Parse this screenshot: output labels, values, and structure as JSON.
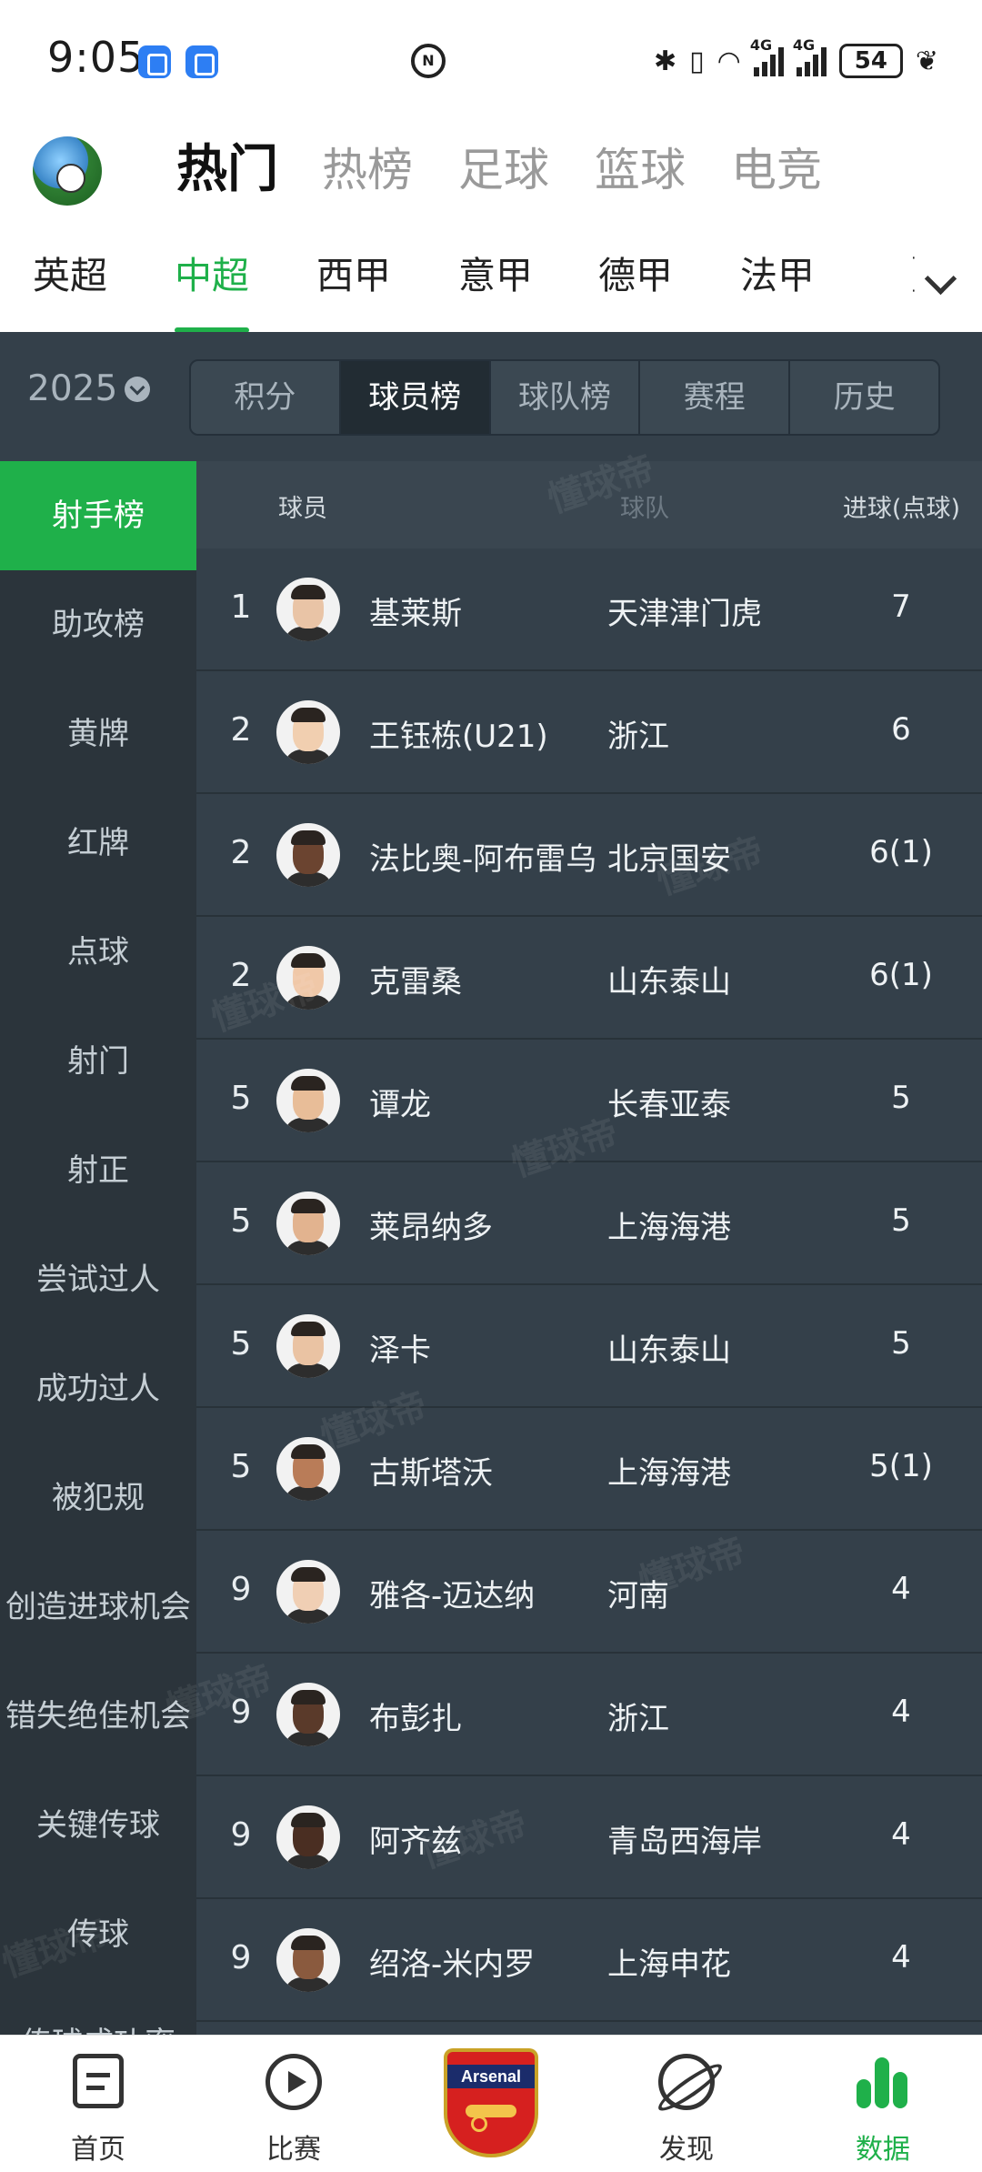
{
  "status_bar": {
    "time": "9:05",
    "battery": "54",
    "network_1": "4G",
    "network_2": "4G",
    "icons": [
      "app-icon",
      "app-icon",
      "nfc-icon",
      "bluetooth-icon",
      "vibrate-icon",
      "wifi-icon",
      "signal-icon",
      "signal-icon",
      "battery-icon",
      "leaf-icon"
    ]
  },
  "top_nav": {
    "tabs": [
      {
        "label": "热门",
        "active": true
      },
      {
        "label": "热榜",
        "active": false
      },
      {
        "label": "足球",
        "active": false
      },
      {
        "label": "篮球",
        "active": false
      },
      {
        "label": "电竞",
        "active": false
      }
    ]
  },
  "leagues": {
    "items": [
      {
        "label": "英超",
        "active": false
      },
      {
        "label": "中超",
        "active": true
      },
      {
        "label": "西甲",
        "active": false
      },
      {
        "label": "意甲",
        "active": false
      },
      {
        "label": "德甲",
        "active": false
      },
      {
        "label": "法甲",
        "active": false
      },
      {
        "label": "［",
        "active": false
      }
    ],
    "accent": "#1fb04a"
  },
  "filter": {
    "year": "2025",
    "segments": [
      {
        "label": "积分",
        "active": false
      },
      {
        "label": "球员榜",
        "active": true
      },
      {
        "label": "球队榜",
        "active": false
      },
      {
        "label": "赛程",
        "active": false
      },
      {
        "label": "历史",
        "active": false
      }
    ]
  },
  "sidebar": {
    "items": [
      {
        "label": "射手榜",
        "active": true
      },
      {
        "label": "助攻榜",
        "active": false
      },
      {
        "label": "黄牌",
        "active": false
      },
      {
        "label": "红牌",
        "active": false
      },
      {
        "label": "点球",
        "active": false
      },
      {
        "label": "射门",
        "active": false
      },
      {
        "label": "射正",
        "active": false
      },
      {
        "label": "尝试过人",
        "active": false
      },
      {
        "label": "成功过人",
        "active": false
      },
      {
        "label": "被犯规",
        "active": false
      },
      {
        "label": "创造进球机会",
        "active": false
      },
      {
        "label": "错失绝佳机会",
        "active": false
      },
      {
        "label": "关键传球",
        "active": false
      },
      {
        "label": "传球",
        "active": false
      },
      {
        "label": "传球成功率",
        "active": false
      }
    ]
  },
  "table": {
    "headers": {
      "player": "球员",
      "team": "球队",
      "goals": "进球(点球)"
    },
    "rows": [
      {
        "rank": "1",
        "player": "基莱斯",
        "team": "天津津门虎",
        "goals": "7"
      },
      {
        "rank": "2",
        "player": "王钰栋(U21)",
        "team": "浙江",
        "goals": "6"
      },
      {
        "rank": "2",
        "player": "法比奥-阿布雷乌",
        "team": "北京国安",
        "goals": "6(1)"
      },
      {
        "rank": "2",
        "player": "克雷桑",
        "team": "山东泰山",
        "goals": "6(1)"
      },
      {
        "rank": "5",
        "player": "谭龙",
        "team": "长春亚泰",
        "goals": "5"
      },
      {
        "rank": "5",
        "player": "莱昂纳多",
        "team": "上海海港",
        "goals": "5"
      },
      {
        "rank": "5",
        "player": "泽卡",
        "team": "山东泰山",
        "goals": "5"
      },
      {
        "rank": "5",
        "player": "古斯塔沃",
        "team": "上海海港",
        "goals": "5(1)"
      },
      {
        "rank": "9",
        "player": "雅各-迈达纳",
        "team": "河南",
        "goals": "4"
      },
      {
        "rank": "9",
        "player": "布彭扎",
        "team": "浙江",
        "goals": "4"
      },
      {
        "rank": "9",
        "player": "阿齐兹",
        "team": "青岛西海岸",
        "goals": "4"
      },
      {
        "rank": "9",
        "player": "绍洛-米内罗",
        "team": "上海申花",
        "goals": "4"
      }
    ]
  },
  "watermark": "懂球帝",
  "bottom_nav": {
    "items": [
      {
        "label": "首页",
        "icon": "home-icon",
        "active": false
      },
      {
        "label": "比赛",
        "icon": "play-icon",
        "active": false
      },
      {
        "label": "",
        "icon": "arsenal-crest-icon",
        "active": false
      },
      {
        "label": "发现",
        "icon": "discover-icon",
        "active": false
      },
      {
        "label": "数据",
        "icon": "data-icon",
        "active": true
      }
    ],
    "crest_text": "Arsenal"
  }
}
